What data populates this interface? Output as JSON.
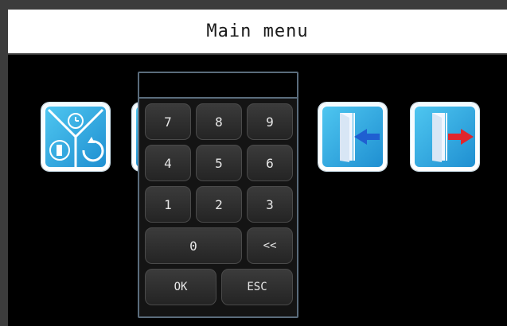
{
  "header": {
    "title": "Main menu"
  },
  "keypad": {
    "display_value": "",
    "keys": [
      {
        "label": "7"
      },
      {
        "label": "8"
      },
      {
        "label": "9"
      },
      {
        "label": "4"
      },
      {
        "label": "5"
      },
      {
        "label": "6"
      },
      {
        "label": "1"
      },
      {
        "label": "2"
      },
      {
        "label": "3"
      },
      {
        "label": "0"
      },
      {
        "label": "<<"
      },
      {
        "label": "OK"
      },
      {
        "label": "ESC"
      }
    ]
  },
  "icons": [
    {
      "name": "settings-mode-icon"
    },
    {
      "name": "door-enter-icon"
    },
    {
      "name": "door-exit-icon"
    }
  ],
  "colors": {
    "accent_blue": "#1f8fd1",
    "arrow_enter": "#1f5fd1",
    "arrow_exit": "#e0262c"
  }
}
